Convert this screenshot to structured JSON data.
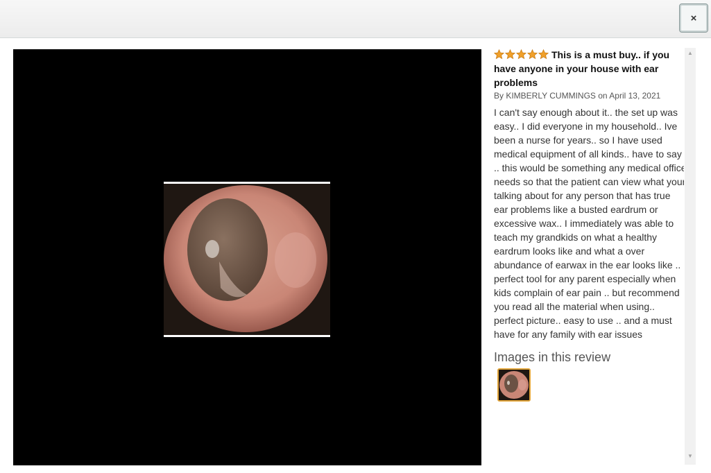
{
  "header": {
    "close_label": "×"
  },
  "review": {
    "rating": 5,
    "title": "This is a must buy.. if you have anyone in your house with ear problems",
    "byline": "By KIMBERLY CUMMINGS on April 13, 2021",
    "body": "I can't say enough about it.. the set up was easy.. I did everyone in my household.. Ive been a nurse for years.. so I have used medical equipment of all kinds.. have to say .. this would be something any medical office needs so that the patient can view what your talking about for any person that has true ear problems like a busted eardrum or excessive wax.. I immediately was able to teach my grandkids on what a healthy eardrum looks like and what a over abundance of earwax in the ear looks like .. perfect tool for any parent especially when kids complain of ear pain .. but recommend you read all the material when using.. perfect picture.. easy to use .. and a must have for any family with ear issues",
    "images_heading": "Images in this review"
  },
  "colors": {
    "star": "#f0a02a",
    "star_outline": "#c77a14",
    "thumb_border": "#e3a63a",
    "viewer_bg": "#000000"
  },
  "icons": {
    "close": "close-icon",
    "star": "star-icon",
    "scroll_up": "scroll-up-icon",
    "scroll_down": "scroll-down-icon"
  }
}
